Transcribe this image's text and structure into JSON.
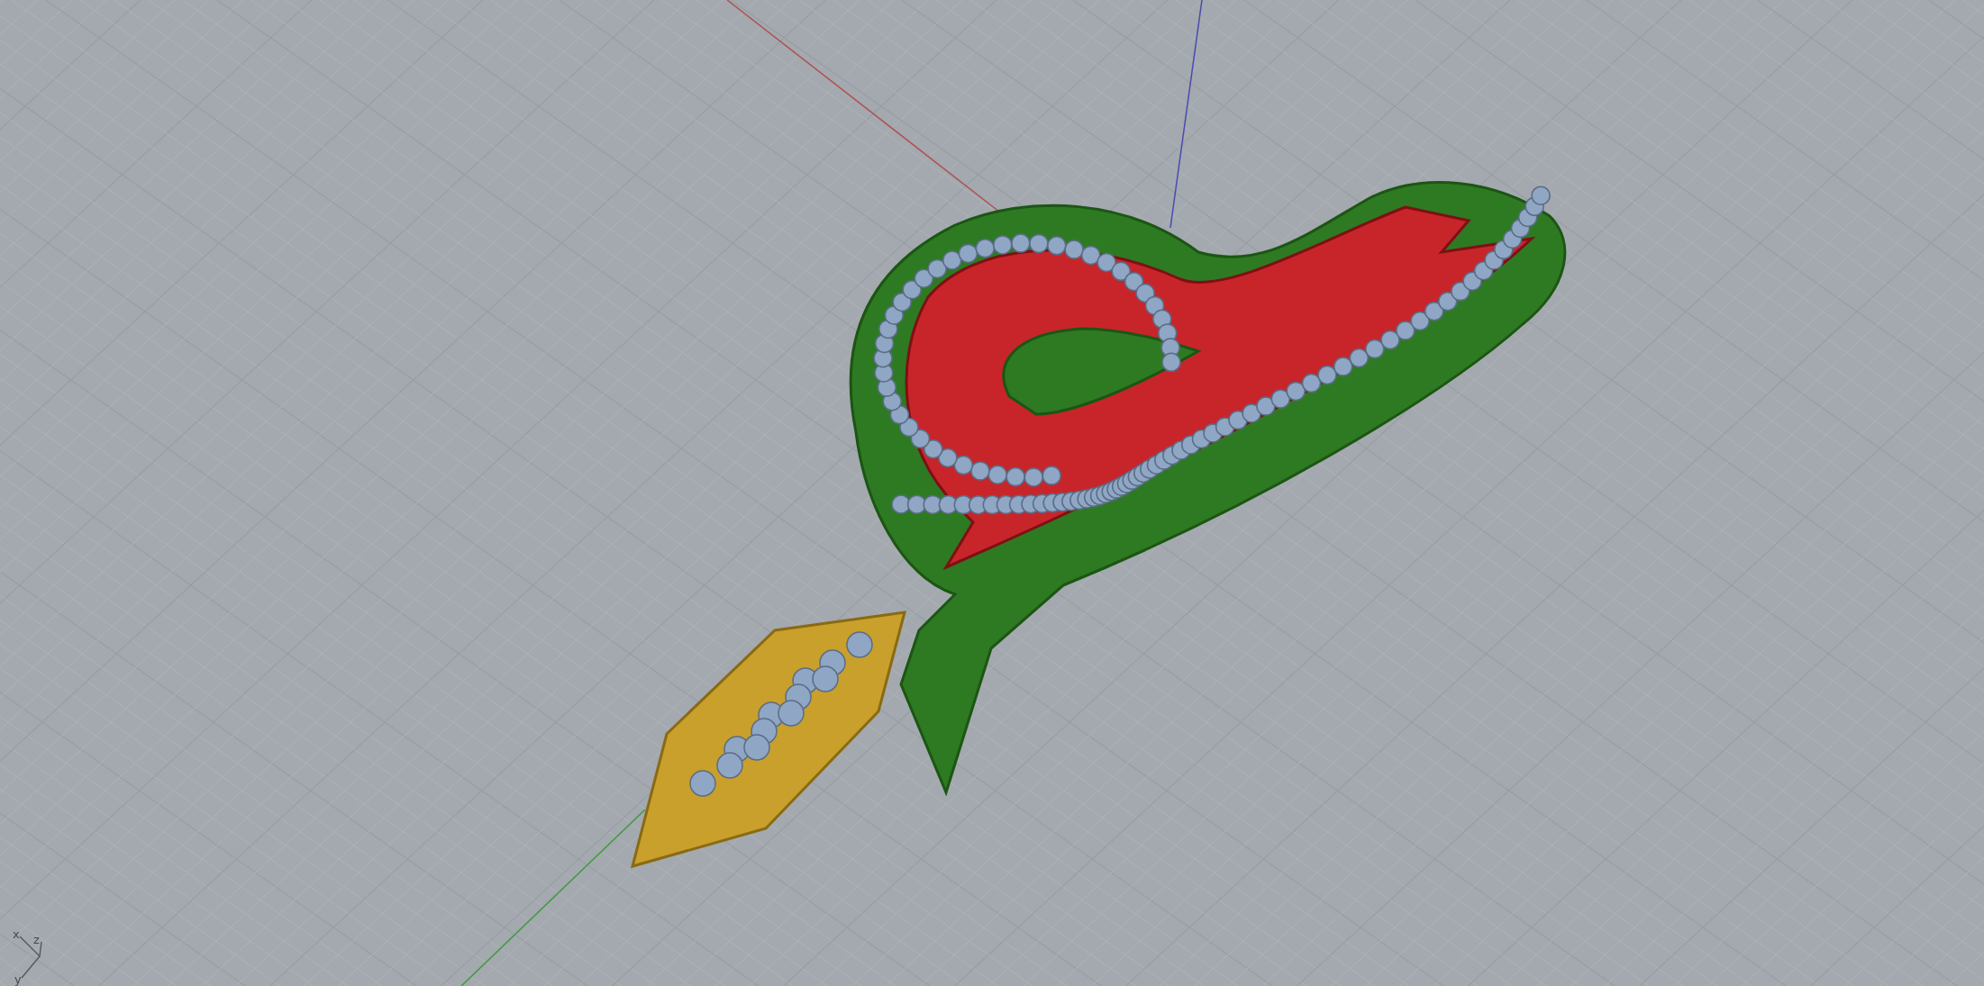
{
  "viewport": {
    "axis_gizmo": {
      "labels": [
        "x",
        "z",
        "y"
      ]
    }
  }
}
